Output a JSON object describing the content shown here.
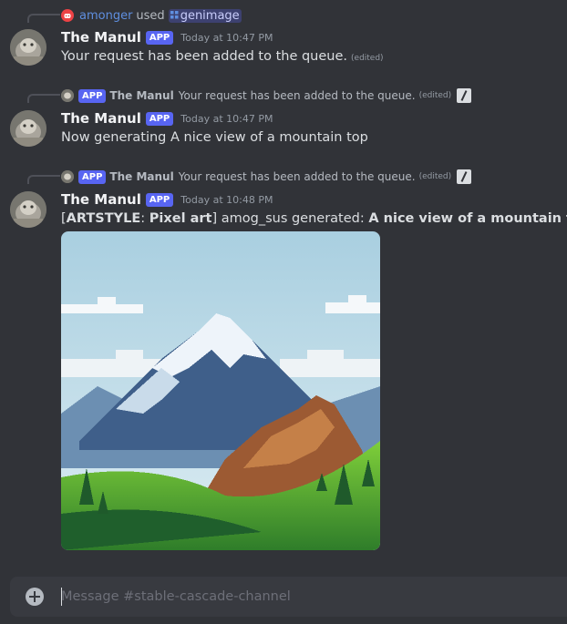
{
  "colors": {
    "background": "#313338",
    "input_bg": "#383a40",
    "badge": "#5865f2",
    "username": "#f2f3f5",
    "muted": "#949ba4"
  },
  "messages": [
    {
      "reply": {
        "icon": "discord-icon",
        "user": "amonger",
        "used": "used",
        "command": "genimage"
      },
      "author": "The Manul",
      "badge": "APP",
      "time": "Today at 10:47 PM",
      "text": "Your request has been added to the queue.",
      "edited": "(edited)"
    },
    {
      "reply": {
        "badge": "APP",
        "author": "The Manul",
        "text": "Your request has been added to the queue.",
        "edited": "(edited)"
      },
      "author": "The Manul",
      "badge": "APP",
      "time": "Today at 10:47 PM",
      "text": "Now generating A nice view of a mountain top"
    },
    {
      "reply": {
        "badge": "APP",
        "author": "The Manul",
        "text": "Your request has been added to the queue.",
        "edited": "(edited)"
      },
      "author": "The Manul",
      "badge": "APP",
      "time": "Today at 10:48 PM",
      "content": {
        "open": "[",
        "label": "ARTSTYLE",
        "colon": ":",
        "style": "Pixel art",
        "close": "]",
        "user_text": "amog_sus generated:",
        "prompt": "A nice view of a mountain top"
      },
      "image_icon": "generated-mountain-image"
    }
  ],
  "chatbox": {
    "placeholder": "Message #stable-cascade-channel",
    "value": ""
  }
}
